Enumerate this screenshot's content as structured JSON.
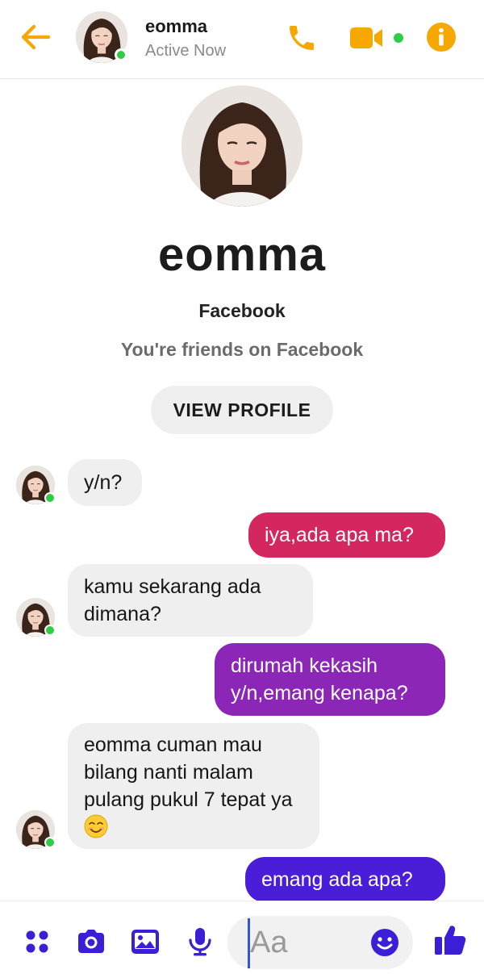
{
  "header": {
    "name": "eomma",
    "status": "Active Now",
    "accent_color": "#f7a800",
    "presence_color": "#31cc46"
  },
  "icons": {
    "back": "arrow-left-icon",
    "call": "phone-icon",
    "video": "video-camera-icon",
    "info": "info-icon",
    "more": "four-dots-icon",
    "camera": "camera-icon",
    "gallery": "image-icon",
    "mic": "microphone-icon",
    "emoji": "smiley-icon",
    "like": "thumbs-up-icon"
  },
  "profile": {
    "name": "eomma",
    "source": "Facebook",
    "relation": "You're friends on Facebook",
    "view_profile_label": "VIEW PROFILE"
  },
  "messages": [
    {
      "from": "them",
      "text": "y/n?"
    },
    {
      "from": "me",
      "text": "iya,ada apa ma?",
      "color": "#d5275f"
    },
    {
      "from": "them",
      "text": "kamu sekarang ada dimana?"
    },
    {
      "from": "me",
      "text": "dirumah kekasih y/n,emang kenapa?",
      "color": "#8b26b7"
    },
    {
      "from": "them",
      "text": "eomma cuman mau bilang nanti malam pulang pukul 7 tepat ya",
      "emoji": "smiling-face-with-smiling-eyes"
    },
    {
      "from": "me",
      "text": "emang ada apa?",
      "color": "#4a1ed8"
    }
  ],
  "composer": {
    "placeholder": "Aa",
    "icon_color": "#3b1fd6"
  }
}
